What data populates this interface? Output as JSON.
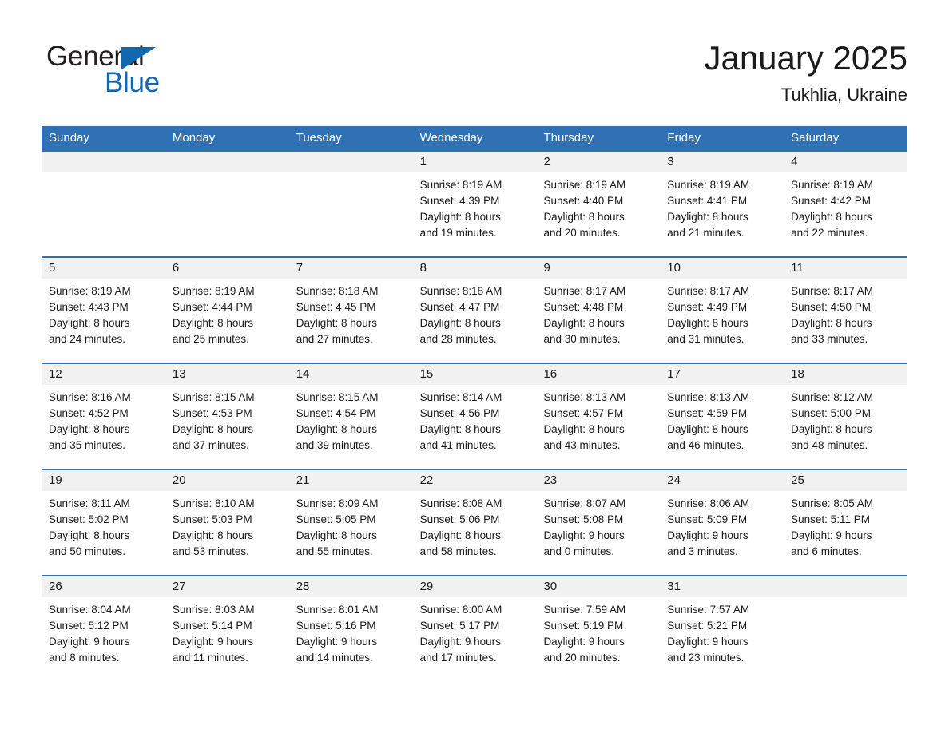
{
  "brand": {
    "word1": "General",
    "word2": "Blue",
    "triangle_icon": "triangle-icon",
    "color_dark": "#231f20",
    "color_blue": "#1168b0"
  },
  "header": {
    "title": "January 2025",
    "location": "Tukhlia, Ukraine"
  },
  "colors": {
    "header_blue": "#2f71b4",
    "row_border_blue": "#2f71b4",
    "daynum_band": "#f1f1f1",
    "text": "#1b1b1b"
  },
  "calendar": {
    "weekday_headers": [
      "Sunday",
      "Monday",
      "Tuesday",
      "Wednesday",
      "Thursday",
      "Friday",
      "Saturday"
    ],
    "weeks": [
      [
        {
          "day": "",
          "empty": true,
          "sunrise": "",
          "sunset": "",
          "daylight_line1": "",
          "daylight_line2": ""
        },
        {
          "day": "",
          "empty": true,
          "sunrise": "",
          "sunset": "",
          "daylight_line1": "",
          "daylight_line2": ""
        },
        {
          "day": "",
          "empty": true,
          "sunrise": "",
          "sunset": "",
          "daylight_line1": "",
          "daylight_line2": ""
        },
        {
          "day": "1",
          "empty": false,
          "sunrise": "Sunrise: 8:19 AM",
          "sunset": "Sunset: 4:39 PM",
          "daylight_line1": "Daylight: 8 hours",
          "daylight_line2": "and 19 minutes."
        },
        {
          "day": "2",
          "empty": false,
          "sunrise": "Sunrise: 8:19 AM",
          "sunset": "Sunset: 4:40 PM",
          "daylight_line1": "Daylight: 8 hours",
          "daylight_line2": "and 20 minutes."
        },
        {
          "day": "3",
          "empty": false,
          "sunrise": "Sunrise: 8:19 AM",
          "sunset": "Sunset: 4:41 PM",
          "daylight_line1": "Daylight: 8 hours",
          "daylight_line2": "and 21 minutes."
        },
        {
          "day": "4",
          "empty": false,
          "sunrise": "Sunrise: 8:19 AM",
          "sunset": "Sunset: 4:42 PM",
          "daylight_line1": "Daylight: 8 hours",
          "daylight_line2": "and 22 minutes."
        }
      ],
      [
        {
          "day": "5",
          "empty": false,
          "sunrise": "Sunrise: 8:19 AM",
          "sunset": "Sunset: 4:43 PM",
          "daylight_line1": "Daylight: 8 hours",
          "daylight_line2": "and 24 minutes."
        },
        {
          "day": "6",
          "empty": false,
          "sunrise": "Sunrise: 8:19 AM",
          "sunset": "Sunset: 4:44 PM",
          "daylight_line1": "Daylight: 8 hours",
          "daylight_line2": "and 25 minutes."
        },
        {
          "day": "7",
          "empty": false,
          "sunrise": "Sunrise: 8:18 AM",
          "sunset": "Sunset: 4:45 PM",
          "daylight_line1": "Daylight: 8 hours",
          "daylight_line2": "and 27 minutes."
        },
        {
          "day": "8",
          "empty": false,
          "sunrise": "Sunrise: 8:18 AM",
          "sunset": "Sunset: 4:47 PM",
          "daylight_line1": "Daylight: 8 hours",
          "daylight_line2": "and 28 minutes."
        },
        {
          "day": "9",
          "empty": false,
          "sunrise": "Sunrise: 8:17 AM",
          "sunset": "Sunset: 4:48 PM",
          "daylight_line1": "Daylight: 8 hours",
          "daylight_line2": "and 30 minutes."
        },
        {
          "day": "10",
          "empty": false,
          "sunrise": "Sunrise: 8:17 AM",
          "sunset": "Sunset: 4:49 PM",
          "daylight_line1": "Daylight: 8 hours",
          "daylight_line2": "and 31 minutes."
        },
        {
          "day": "11",
          "empty": false,
          "sunrise": "Sunrise: 8:17 AM",
          "sunset": "Sunset: 4:50 PM",
          "daylight_line1": "Daylight: 8 hours",
          "daylight_line2": "and 33 minutes."
        }
      ],
      [
        {
          "day": "12",
          "empty": false,
          "sunrise": "Sunrise: 8:16 AM",
          "sunset": "Sunset: 4:52 PM",
          "daylight_line1": "Daylight: 8 hours",
          "daylight_line2": "and 35 minutes."
        },
        {
          "day": "13",
          "empty": false,
          "sunrise": "Sunrise: 8:15 AM",
          "sunset": "Sunset: 4:53 PM",
          "daylight_line1": "Daylight: 8 hours",
          "daylight_line2": "and 37 minutes."
        },
        {
          "day": "14",
          "empty": false,
          "sunrise": "Sunrise: 8:15 AM",
          "sunset": "Sunset: 4:54 PM",
          "daylight_line1": "Daylight: 8 hours",
          "daylight_line2": "and 39 minutes."
        },
        {
          "day": "15",
          "empty": false,
          "sunrise": "Sunrise: 8:14 AM",
          "sunset": "Sunset: 4:56 PM",
          "daylight_line1": "Daylight: 8 hours",
          "daylight_line2": "and 41 minutes."
        },
        {
          "day": "16",
          "empty": false,
          "sunrise": "Sunrise: 8:13 AM",
          "sunset": "Sunset: 4:57 PM",
          "daylight_line1": "Daylight: 8 hours",
          "daylight_line2": "and 43 minutes."
        },
        {
          "day": "17",
          "empty": false,
          "sunrise": "Sunrise: 8:13 AM",
          "sunset": "Sunset: 4:59 PM",
          "daylight_line1": "Daylight: 8 hours",
          "daylight_line2": "and 46 minutes."
        },
        {
          "day": "18",
          "empty": false,
          "sunrise": "Sunrise: 8:12 AM",
          "sunset": "Sunset: 5:00 PM",
          "daylight_line1": "Daylight: 8 hours",
          "daylight_line2": "and 48 minutes."
        }
      ],
      [
        {
          "day": "19",
          "empty": false,
          "sunrise": "Sunrise: 8:11 AM",
          "sunset": "Sunset: 5:02 PM",
          "daylight_line1": "Daylight: 8 hours",
          "daylight_line2": "and 50 minutes."
        },
        {
          "day": "20",
          "empty": false,
          "sunrise": "Sunrise: 8:10 AM",
          "sunset": "Sunset: 5:03 PM",
          "daylight_line1": "Daylight: 8 hours",
          "daylight_line2": "and 53 minutes."
        },
        {
          "day": "21",
          "empty": false,
          "sunrise": "Sunrise: 8:09 AM",
          "sunset": "Sunset: 5:05 PM",
          "daylight_line1": "Daylight: 8 hours",
          "daylight_line2": "and 55 minutes."
        },
        {
          "day": "22",
          "empty": false,
          "sunrise": "Sunrise: 8:08 AM",
          "sunset": "Sunset: 5:06 PM",
          "daylight_line1": "Daylight: 8 hours",
          "daylight_line2": "and 58 minutes."
        },
        {
          "day": "23",
          "empty": false,
          "sunrise": "Sunrise: 8:07 AM",
          "sunset": "Sunset: 5:08 PM",
          "daylight_line1": "Daylight: 9 hours",
          "daylight_line2": "and 0 minutes."
        },
        {
          "day": "24",
          "empty": false,
          "sunrise": "Sunrise: 8:06 AM",
          "sunset": "Sunset: 5:09 PM",
          "daylight_line1": "Daylight: 9 hours",
          "daylight_line2": "and 3 minutes."
        },
        {
          "day": "25",
          "empty": false,
          "sunrise": "Sunrise: 8:05 AM",
          "sunset": "Sunset: 5:11 PM",
          "daylight_line1": "Daylight: 9 hours",
          "daylight_line2": "and 6 minutes."
        }
      ],
      [
        {
          "day": "26",
          "empty": false,
          "sunrise": "Sunrise: 8:04 AM",
          "sunset": "Sunset: 5:12 PM",
          "daylight_line1": "Daylight: 9 hours",
          "daylight_line2": "and 8 minutes."
        },
        {
          "day": "27",
          "empty": false,
          "sunrise": "Sunrise: 8:03 AM",
          "sunset": "Sunset: 5:14 PM",
          "daylight_line1": "Daylight: 9 hours",
          "daylight_line2": "and 11 minutes."
        },
        {
          "day": "28",
          "empty": false,
          "sunrise": "Sunrise: 8:01 AM",
          "sunset": "Sunset: 5:16 PM",
          "daylight_line1": "Daylight: 9 hours",
          "daylight_line2": "and 14 minutes."
        },
        {
          "day": "29",
          "empty": false,
          "sunrise": "Sunrise: 8:00 AM",
          "sunset": "Sunset: 5:17 PM",
          "daylight_line1": "Daylight: 9 hours",
          "daylight_line2": "and 17 minutes."
        },
        {
          "day": "30",
          "empty": false,
          "sunrise": "Sunrise: 7:59 AM",
          "sunset": "Sunset: 5:19 PM",
          "daylight_line1": "Daylight: 9 hours",
          "daylight_line2": "and 20 minutes."
        },
        {
          "day": "31",
          "empty": false,
          "sunrise": "Sunrise: 7:57 AM",
          "sunset": "Sunset: 5:21 PM",
          "daylight_line1": "Daylight: 9 hours",
          "daylight_line2": "and 23 minutes."
        },
        {
          "day": "",
          "empty": true,
          "sunrise": "",
          "sunset": "",
          "daylight_line1": "",
          "daylight_line2": ""
        }
      ]
    ]
  }
}
